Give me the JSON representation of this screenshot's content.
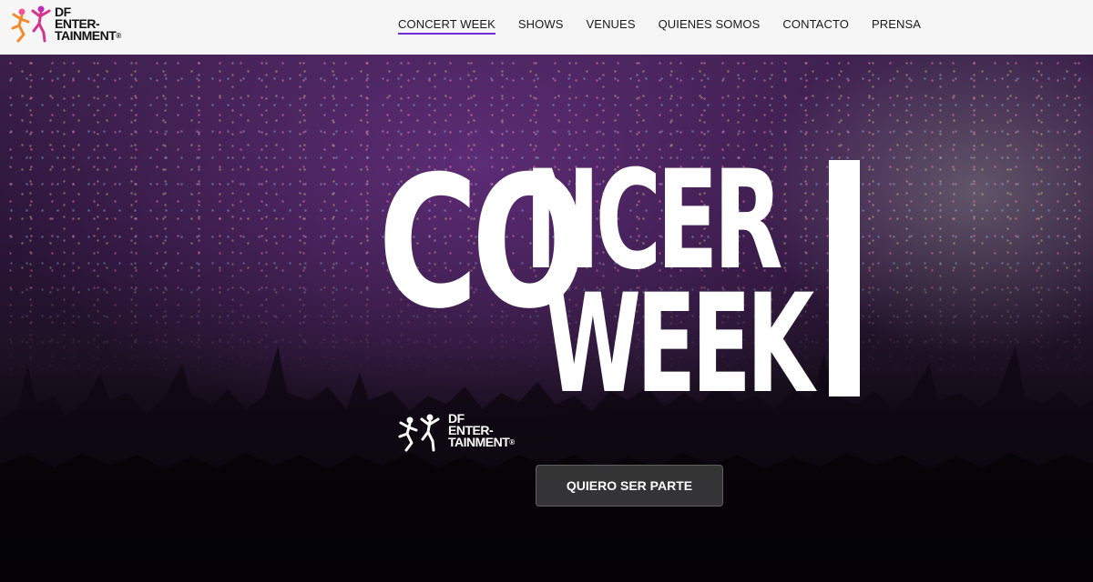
{
  "brand": {
    "name_line1": "DF",
    "name_line2": "ENTER-",
    "name_line3": "TAINMENT",
    "trademark": "®",
    "logo_icon": "dancing-figures-icon",
    "logo_colors": [
      "#f0569a",
      "#c02bb4",
      "#f28b2c",
      "#8a2be2"
    ]
  },
  "nav": {
    "items": [
      {
        "label": "CONCERT WEEK",
        "active": true
      },
      {
        "label": "SHOWS",
        "active": false
      },
      {
        "label": "VENUES",
        "active": false
      },
      {
        "label": "QUIENES SOMOS",
        "active": false
      },
      {
        "label": "CONTACTO",
        "active": false
      },
      {
        "label": "PRENSA",
        "active": false
      }
    ],
    "active_underline_color": "#6f2bd6"
  },
  "hero": {
    "title_part1": "CO",
    "title_part2": "NCER",
    "title_part3": "WEEK",
    "logo_line1": "DF",
    "logo_line2": "ENTER-",
    "logo_line3": "TAINMENT",
    "logo_trademark": "®",
    "cta_label": "QUIERO SER PARTE"
  },
  "colors": {
    "accent": "#6f2bd6",
    "hero_text": "#ffffff",
    "nav_bg": "#f6f6f6"
  }
}
